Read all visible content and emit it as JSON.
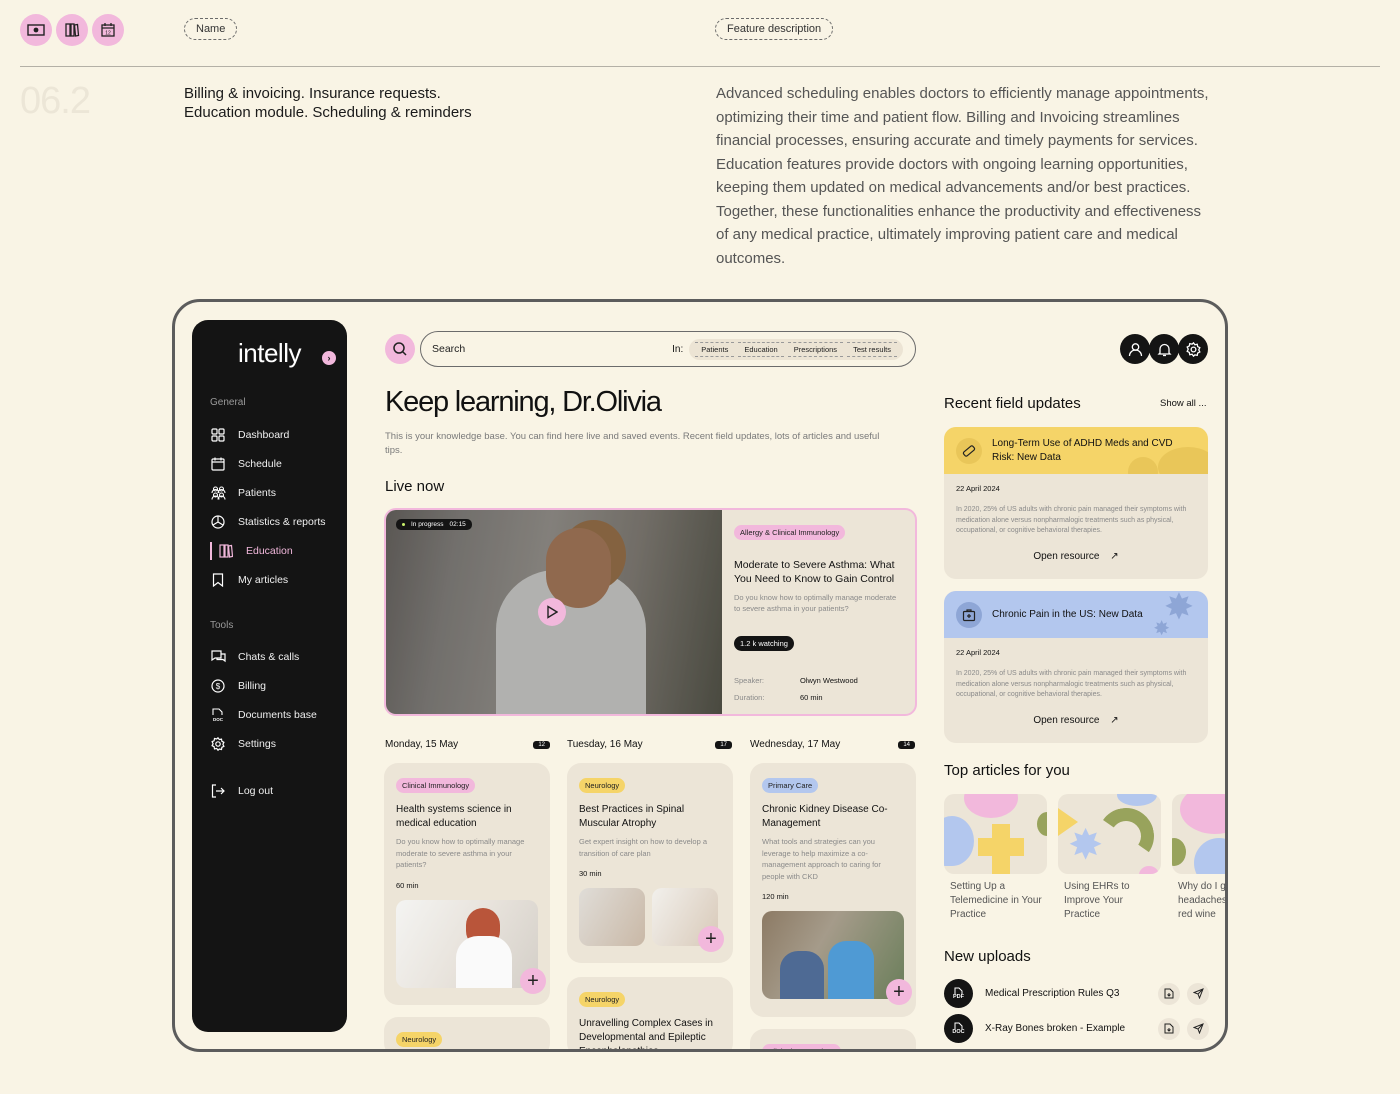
{
  "header": {
    "icons": [
      "banknote-icon",
      "books-icon",
      "calendar-icon"
    ],
    "name_pill": "Name",
    "feature_pill": "Feature description",
    "section_number": "06.2",
    "subtitle_line1": "Billing & invoicing. Insurance requests.",
    "subtitle_line2": "Education module. Scheduling & reminders",
    "feature_description": "Advanced scheduling enables doctors to efficiently manage appointments, optimizing their time and patient flow. Billing and Invoicing streamlines financial processes, ensuring accurate and timely payments for services. Education features provide doctors with ongoing learning opportunities, keeping them updated on medical advancements and/or best practices. Together, these functionalities enhance the productivity and effectiveness of any medical practice, ultimately improving patient care and medical outcomes."
  },
  "app": {
    "logo": "intelly",
    "sidebar": {
      "general_label": "General",
      "general_items": [
        {
          "label": "Dashboard",
          "icon": "grid-icon"
        },
        {
          "label": "Schedule",
          "icon": "calendar-icon"
        },
        {
          "label": "Patients",
          "icon": "users-icon"
        },
        {
          "label": "Statistics & reports",
          "icon": "pie-chart-icon"
        },
        {
          "label": "Education",
          "icon": "books-icon",
          "active": true
        },
        {
          "label": "My articles",
          "icon": "bookmark-icon"
        }
      ],
      "tools_label": "Tools",
      "tools_items": [
        {
          "label": "Chats & calls",
          "icon": "chat-icon"
        },
        {
          "label": "Billing",
          "icon": "dollar-icon"
        },
        {
          "label": "Documents base",
          "icon": "doc-icon"
        },
        {
          "label": "Settings",
          "icon": "gear-icon"
        }
      ],
      "logout": "Log out"
    },
    "search": {
      "placeholder": "Search",
      "in_label": "In:",
      "filters": [
        "Patients",
        "Education",
        "Prescriptions",
        "Test results"
      ]
    },
    "title": "Keep learning, Dr.Olivia",
    "lead": "This is your knowledge base. You can find here live and saved events. Recent field updates, lots of articles and useful tips.",
    "live": {
      "heading": "Live now",
      "status": "In progress",
      "time": "02:15",
      "tag": "Allergy & Clinical Immunology",
      "title": "Moderate to Severe Asthma: What You Need to Know to Gain Control",
      "desc": "Do you know how to optimally manage moderate to severe asthma in your patients?",
      "watching": "1.2 k watching",
      "speaker_label": "Speaker:",
      "speaker": "Olwyn Westwood",
      "duration_label": "Duration:",
      "duration": "60 min"
    },
    "days": [
      {
        "label": "Monday, 15 May",
        "count": "12",
        "cards": [
          {
            "tag": "Clinical Immunology",
            "color": "pink",
            "title": "Health systems science in medical education",
            "desc": "Do you know how to optimally manage moderate to severe asthma in your patients?",
            "duration": "60 min"
          },
          {
            "tag": "Neurology",
            "color": "yellow"
          }
        ]
      },
      {
        "label": "Tuesday, 16 May",
        "count": "17",
        "cards": [
          {
            "tag": "Neurology",
            "color": "yellow",
            "title": "Best Practices in Spinal Muscular Atrophy",
            "desc": "Get expert insight on how to develop a transition of care plan",
            "duration": "30 min"
          },
          {
            "tag": "Neurology",
            "color": "yellow",
            "title": "Unravelling Complex Cases in Developmental and Epileptic Encephalopathies"
          }
        ]
      },
      {
        "label": "Wednesday, 17 May",
        "count": "14",
        "cards": [
          {
            "tag": "Primary Care",
            "color": "blue",
            "title": "Chronic Kidney Disease Co-Management",
            "desc": "What tools and strategies can you leverage to help maximize a co-management approach to caring for people with CKD",
            "duration": "120 min"
          },
          {
            "tag": "Clinical Immunology",
            "color": "pink"
          }
        ]
      }
    ],
    "updates": {
      "heading": "Recent field updates",
      "show_all": "Show all ...",
      "items": [
        {
          "title": "Long-Term Use of ADHD Meds and CVD Risk: New Data",
          "date": "22 April 2024",
          "body": "In 2020, 25% of US adults with chronic pain managed their symptoms with medication alone versus nonpharmalogic treatments such as physical, occupational, or cognitive behavioral therapies.",
          "link": "Open resource",
          "color": "#f5d468"
        },
        {
          "title": "Chronic Pain in the US: New Data",
          "date": "22 April 2024",
          "body": "In 2020, 25% of US adults with chronic pain managed their symptoms with medication alone versus nonpharmalogic treatments such as physical, occupational, or cognitive behavioral therapies.",
          "link": "Open resource",
          "color": "#b3c7ee"
        }
      ]
    },
    "top_articles": {
      "heading": "Top articles for you",
      "items": [
        "Setting Up a Telemedicine in Your Practice",
        "Using EHRs to Improve Your Practice",
        "Why do I get headaches drinking red wine"
      ]
    },
    "uploads": {
      "heading": "New uploads",
      "items": [
        {
          "type": "PDF",
          "name": "Medical Prescription Rules Q3"
        },
        {
          "type": "DOC",
          "name": "X-Ray Bones broken - Example"
        }
      ]
    }
  }
}
